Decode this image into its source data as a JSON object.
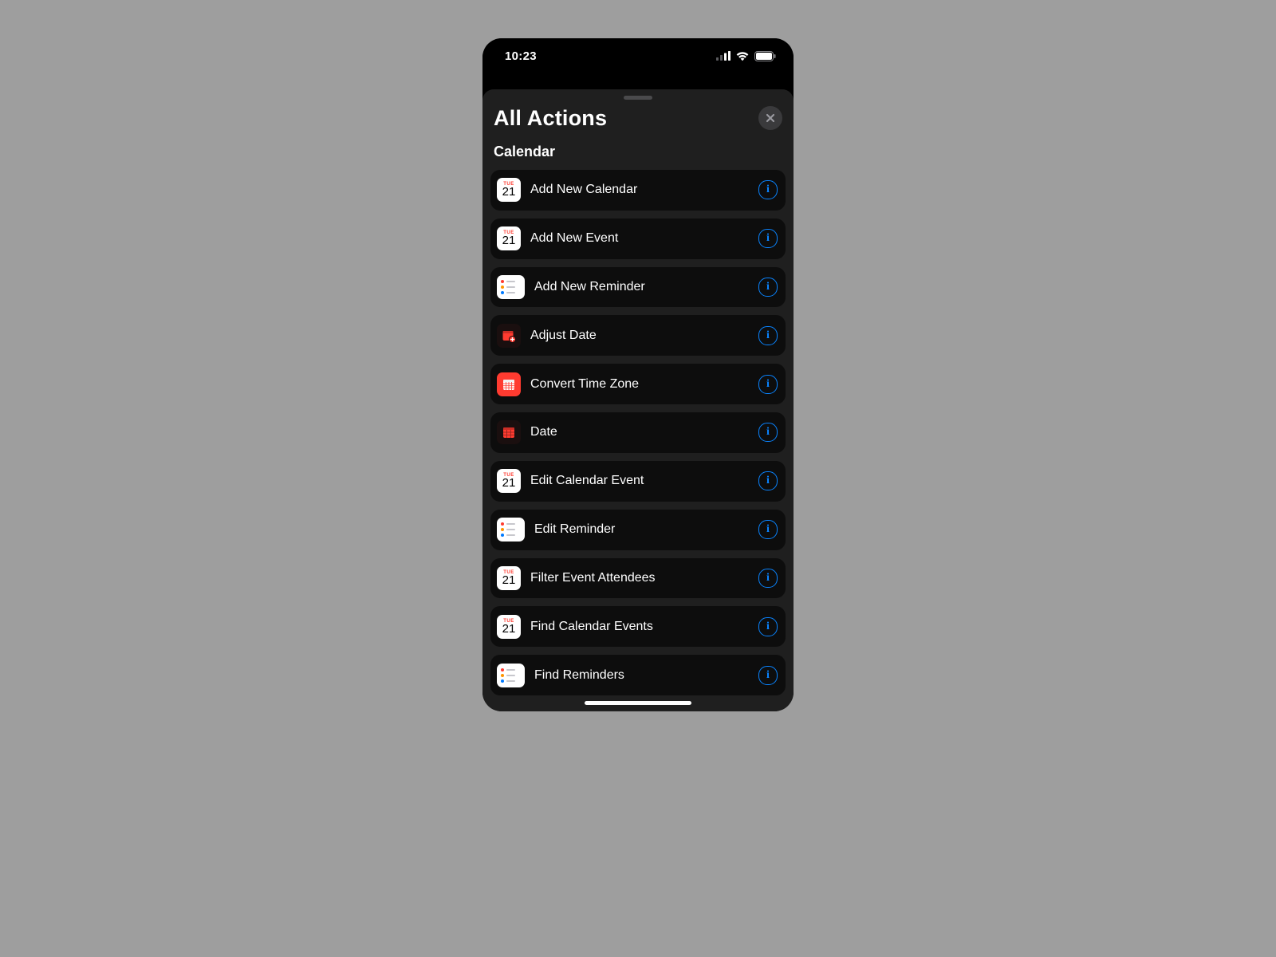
{
  "statusbar": {
    "time": "10:23"
  },
  "sheet": {
    "title": "All Actions",
    "section": "Calendar",
    "actions": [
      {
        "label": "Add New Calendar",
        "icon": "cal21"
      },
      {
        "label": "Add New Event",
        "icon": "cal21"
      },
      {
        "label": "Add New Reminder",
        "icon": "reminders"
      },
      {
        "label": "Adjust Date",
        "icon": "adjust"
      },
      {
        "label": "Convert Time Zone",
        "icon": "convert"
      },
      {
        "label": "Date",
        "icon": "date"
      },
      {
        "label": "Edit Calendar Event",
        "icon": "cal21"
      },
      {
        "label": "Edit Reminder",
        "icon": "reminders"
      },
      {
        "label": "Filter Event Attendees",
        "icon": "cal21"
      },
      {
        "label": "Find Calendar Events",
        "icon": "cal21"
      },
      {
        "label": "Find Reminders",
        "icon": "reminders"
      }
    ]
  },
  "icons": {
    "cal21": {
      "weekday": "TUE",
      "day": "21"
    },
    "reminder_colors": [
      "#ff3b30",
      "#ff9500",
      "#007aff"
    ]
  }
}
